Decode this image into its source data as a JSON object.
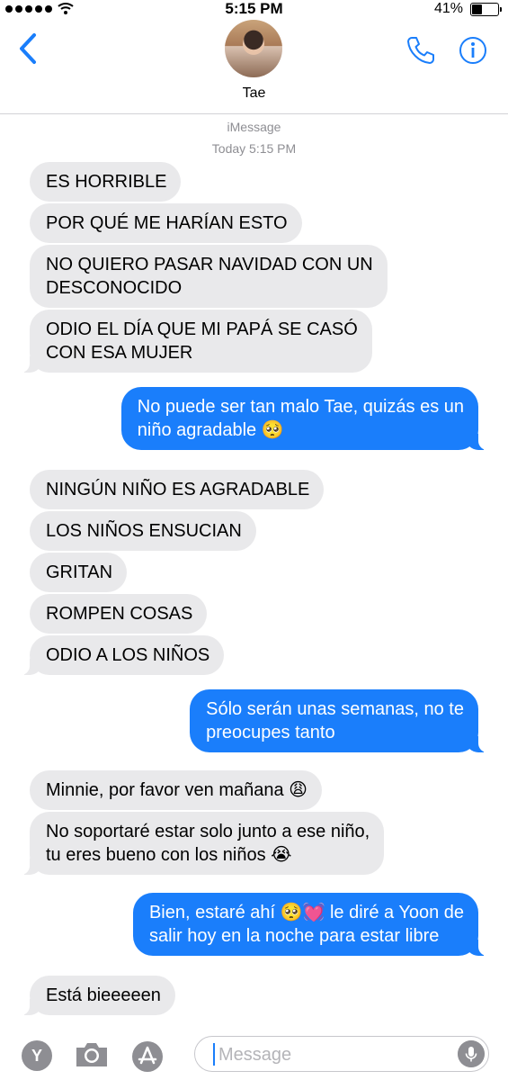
{
  "status_bar": {
    "time": "5:15 PM",
    "battery": "41%",
    "battery_level": 0.41
  },
  "header": {
    "contact_name": "Tae"
  },
  "thread": {
    "service": "iMessage",
    "timestamp": "Today 5:15 PM"
  },
  "messages": [
    {
      "from": "them",
      "text": "ES HORRIBLE"
    },
    {
      "from": "them",
      "text": "POR QUÉ ME HARÍAN ESTO"
    },
    {
      "from": "them",
      "lines": [
        "NO QUIERO PASAR NAVIDAD CON UN",
        "DESCONOCIDO"
      ]
    },
    {
      "from": "them",
      "lines": [
        "ODIO EL DÍA QUE MI PAPÁ SE CASÓ",
        "CON ESA MUJER"
      ]
    },
    {
      "from": "me",
      "lines": [
        "No puede ser tan malo Tae, quizás es un",
        "niño agradable 🥺"
      ]
    },
    {
      "from": "them",
      "text": "NINGÚN NIÑO ES AGRADABLE"
    },
    {
      "from": "them",
      "text": "LOS NIÑOS ENSUCIAN"
    },
    {
      "from": "them",
      "text": "GRITAN"
    },
    {
      "from": "them",
      "text": "ROMPEN COSAS"
    },
    {
      "from": "them",
      "text": "ODIO A LOS NIÑOS"
    },
    {
      "from": "me",
      "lines": [
        "Sólo serán unas semanas, no te",
        "preocupes tanto"
      ]
    },
    {
      "from": "them",
      "text": "Minnie, por favor ven mañana 😩"
    },
    {
      "from": "them",
      "lines": [
        "No soportaré estar solo junto a ese niño,",
        "tu eres bueno con los niños 😭"
      ]
    },
    {
      "from": "me",
      "lines": [
        "Bien, estaré ahí 🥺💓 le diré a Yoon de",
        "salir hoy en la noche para estar libre"
      ]
    },
    {
      "from": "them",
      "text": "Está bieeeeen"
    }
  ],
  "input": {
    "placeholder": "Message"
  },
  "icons": {
    "back": "chevron-left-icon",
    "phone": "phone-icon",
    "info": "info-icon",
    "camera": "camera-icon",
    "apps": "app-store-icon",
    "mic": "microphone-icon"
  },
  "colors": {
    "accent": "#1a7efb",
    "incoming_bubble": "#e9e9eb",
    "muted": "#8e8e93"
  }
}
